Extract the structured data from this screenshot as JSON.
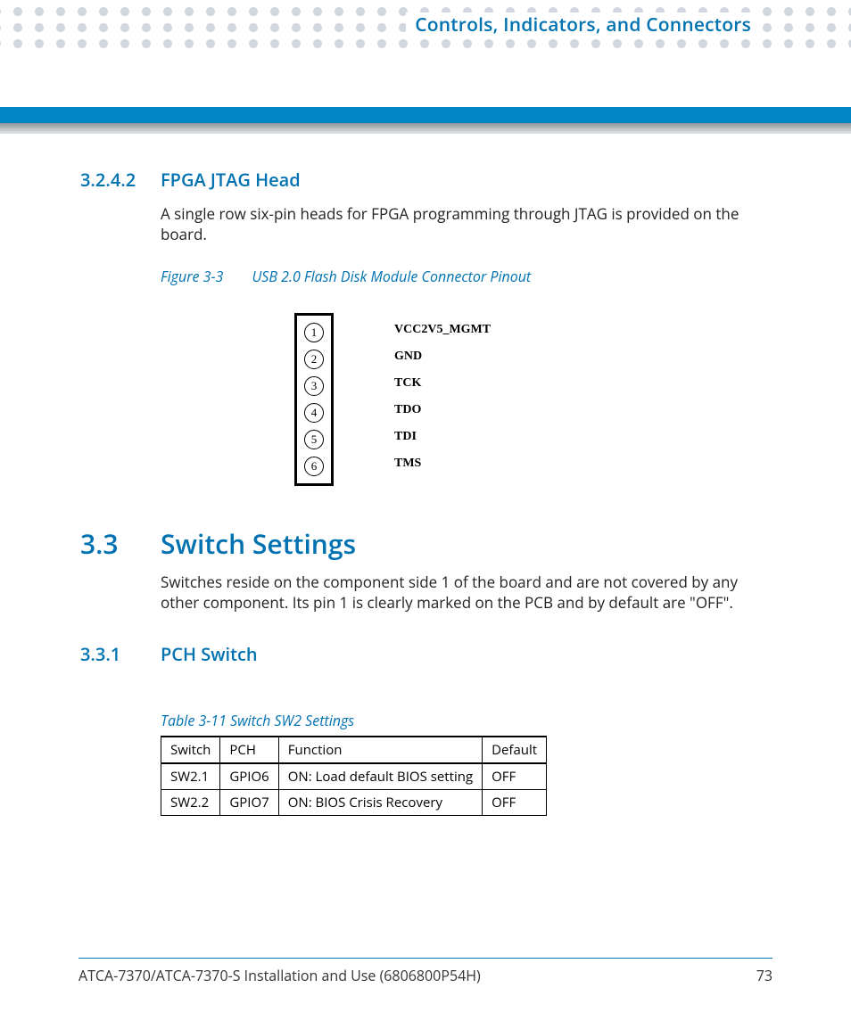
{
  "header": {
    "chapter_title": "Controls, Indicators, and Connectors"
  },
  "sec_3242": {
    "num": "3.2.4.2",
    "title": "FPGA JTAG Head",
    "body": "A single row six-pin heads for FPGA programming through JTAG is provided on the board."
  },
  "figure": {
    "label": "Figure 3-3",
    "title": "USB 2.0 Flash Disk Module Connector Pinout",
    "pins": [
      {
        "n": "1",
        "name": "VCC2V5_MGMT"
      },
      {
        "n": "2",
        "name": "GND"
      },
      {
        "n": "3",
        "name": "TCK"
      },
      {
        "n": "4",
        "name": "TDO"
      },
      {
        "n": "5",
        "name": "TDI"
      },
      {
        "n": "6",
        "name": "TMS"
      }
    ]
  },
  "sec_33": {
    "num": "3.3",
    "title": "Switch Settings",
    "body": "Switches reside on the component side 1 of the board and are not covered by any other component. Its pin 1 is clearly marked on the PCB and by default are \"OFF\"."
  },
  "sec_331": {
    "num": "3.3.1",
    "title": "PCH Switch"
  },
  "table": {
    "caption": "Table 3-11 Switch SW2 Settings",
    "headers": [
      "Switch",
      "PCH",
      "Function",
      "Default"
    ],
    "rows": [
      [
        "SW2.1",
        "GPIO6",
        "ON: Load default BIOS setting",
        "OFF"
      ],
      [
        "SW2.2",
        "GPIO7",
        "ON: BIOS Crisis Recovery",
        "OFF"
      ]
    ]
  },
  "footer": {
    "doc": "ATCA-7370/ATCA-7370-S Installation and Use (6806800P54H)",
    "page": "73"
  }
}
